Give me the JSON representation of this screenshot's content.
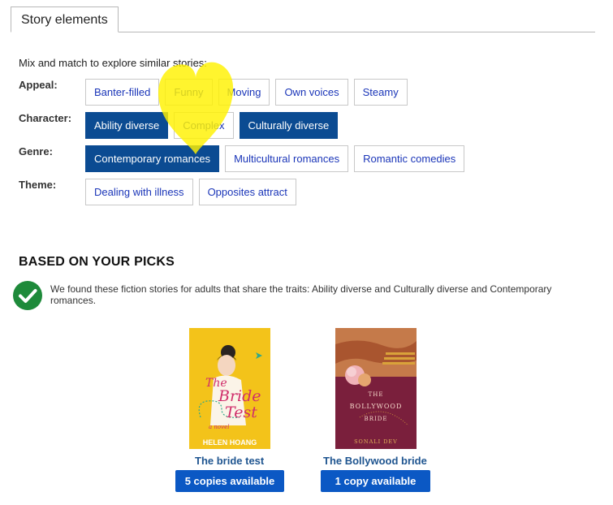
{
  "tab": {
    "label": "Story elements"
  },
  "intro": "Mix and match to explore similar stories:",
  "rows": [
    {
      "label": "Appeal:",
      "chips": [
        {
          "label": "Banter-filled",
          "selected": false
        },
        {
          "label": "Funny",
          "selected": false
        },
        {
          "label": "Moving",
          "selected": false
        },
        {
          "label": "Own voices",
          "selected": false
        },
        {
          "label": "Steamy",
          "selected": false
        }
      ]
    },
    {
      "label": "Character:",
      "chips": [
        {
          "label": "Ability diverse",
          "selected": true
        },
        {
          "label": "Complex",
          "selected": false
        },
        {
          "label": "Culturally diverse",
          "selected": true
        }
      ]
    },
    {
      "label": "Genre:",
      "chips": [
        {
          "label": "Contemporary romances",
          "selected": true
        },
        {
          "label": "Multicultural romances",
          "selected": false
        },
        {
          "label": "Romantic comedies",
          "selected": false
        }
      ]
    },
    {
      "label": "Theme:",
      "chips": [
        {
          "label": "Dealing with illness",
          "selected": false
        },
        {
          "label": "Opposites attract",
          "selected": false
        }
      ]
    }
  ],
  "results": {
    "heading": "BASED ON YOUR PICKS",
    "message": "We found these fiction stories for adults that share the traits: Ability diverse and Culturally diverse and Contemporary romances."
  },
  "books": [
    {
      "title": "The bride test",
      "availability": "5 copies available",
      "cover": {
        "line1": "The",
        "line2": "Bride",
        "line3": "Test",
        "tagline": "a novel",
        "author": "HELEN HOANG",
        "bg": "#f3c31a"
      }
    },
    {
      "title": "The Bollywood bride",
      "availability": "1 copy available",
      "cover": {
        "line1": "THE",
        "line2": "BOLLYWOOD",
        "line3": "BRIDE",
        "author": "SONALI DEV",
        "bg": "#7a1f3c"
      }
    }
  ],
  "colors": {
    "selected_chip": "#0b4b92",
    "chip_text": "#1a35b8",
    "avail_button": "#0b58c4",
    "check": "#1e8a3a",
    "highlight": "#fff200"
  }
}
